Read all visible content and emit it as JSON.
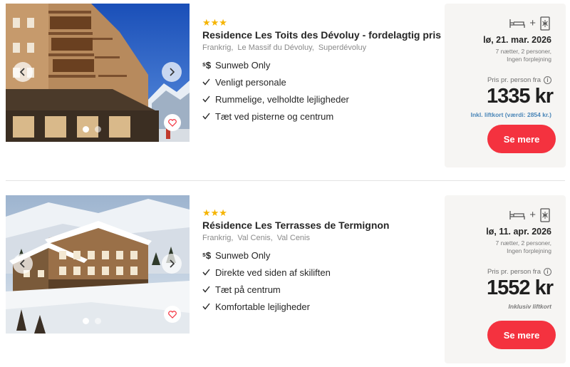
{
  "listings": [
    {
      "stars": "★★★",
      "title": "Residence Les Toits des Dévoluy - fordelagtig pris",
      "location": [
        "Frankrig,",
        "Le Massif du Dévoluy,",
        "Superdévoluy"
      ],
      "features": [
        {
          "icon": "sunweb-only-icon",
          "text": "Sunweb Only"
        },
        {
          "icon": "check-icon",
          "text": "Venligt personale"
        },
        {
          "icon": "check-icon",
          "text": "Rummelige, velholdte lejligheder"
        },
        {
          "icon": "check-icon",
          "text": "Tæt ved pisterne og centrum"
        }
      ],
      "date": "lø, 21. mar. 2026",
      "nights_line1": "7 nætter, 2 personer,",
      "nights_line2": "Ingen forplejning",
      "per_person_label": "Pris pr. person fra",
      "price": "1335 kr",
      "lift_note": "Inkl. liftkort (værdi: 2854 kr.)",
      "cta": "Se mere",
      "photo_slides": 2,
      "photo_active_slide": 1
    },
    {
      "stars": "★★★",
      "title": "Résidence Les Terrasses de Termignon",
      "location": [
        "Frankrig,",
        "Val Cenis,",
        "Val Cenis"
      ],
      "features": [
        {
          "icon": "sunweb-only-icon",
          "text": "Sunweb Only"
        },
        {
          "icon": "check-icon",
          "text": "Direkte ved siden af skiliften"
        },
        {
          "icon": "check-icon",
          "text": "Tæt på centrum"
        },
        {
          "icon": "check-icon",
          "text": "Komfortable lejligheder"
        }
      ],
      "date": "lø, 11. apr. 2026",
      "nights_line1": "7 nætter, 2 personer,",
      "nights_line2": "Ingen forplejning",
      "per_person_label": "Pris pr. person fra",
      "price": "1552 kr",
      "lift_note": "Inklusiv liftkort",
      "cta": "Se mere",
      "photo_slides": 2,
      "photo_active_slide": 1
    }
  ],
  "icons": {
    "accommodation": "bed-icon",
    "plus": "+",
    "skipass": "ski-pass-icon",
    "info": "i",
    "favorite": "heart-icon",
    "prev": "chevron-left-icon",
    "next": "chevron-right-icon"
  },
  "colors": {
    "stars": "#f5b400",
    "cta": "#f4323f",
    "lift_note": "#4a86b8",
    "price_box_bg": "#f6f5f3"
  }
}
